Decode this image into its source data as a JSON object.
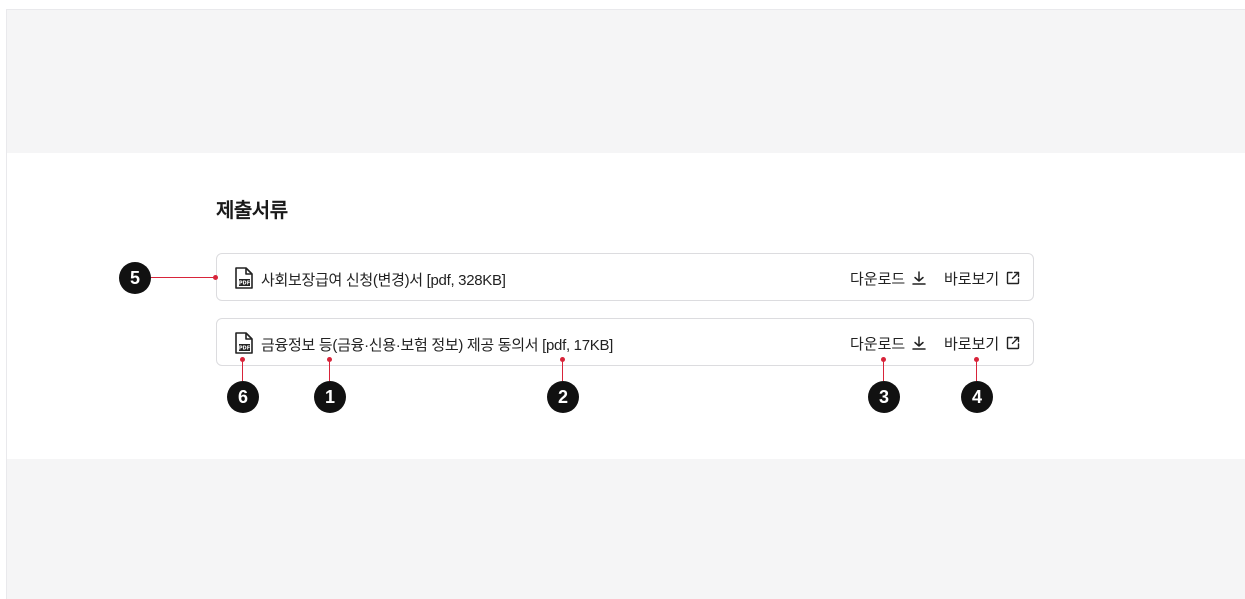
{
  "section": {
    "title": "제출서류"
  },
  "files": [
    {
      "name": "사회보장급여 신청(변경)서 [pdf, 328KB]",
      "download_label": "다운로드",
      "view_label": "바로보기"
    },
    {
      "name": "금융정보 등(금융·신용·보험 정보) 제공 동의서 [pdf, 17KB]",
      "download_label": "다운로드",
      "view_label": "바로보기"
    }
  ],
  "annotations": {
    "m1": "1",
    "m2": "2",
    "m3": "3",
    "m4": "4",
    "m5": "5",
    "m6": "6"
  },
  "colors": {
    "marker": "#111111",
    "pointer": "#d8243a",
    "border": "#dcdcdf",
    "band": "#f5f5f6"
  }
}
